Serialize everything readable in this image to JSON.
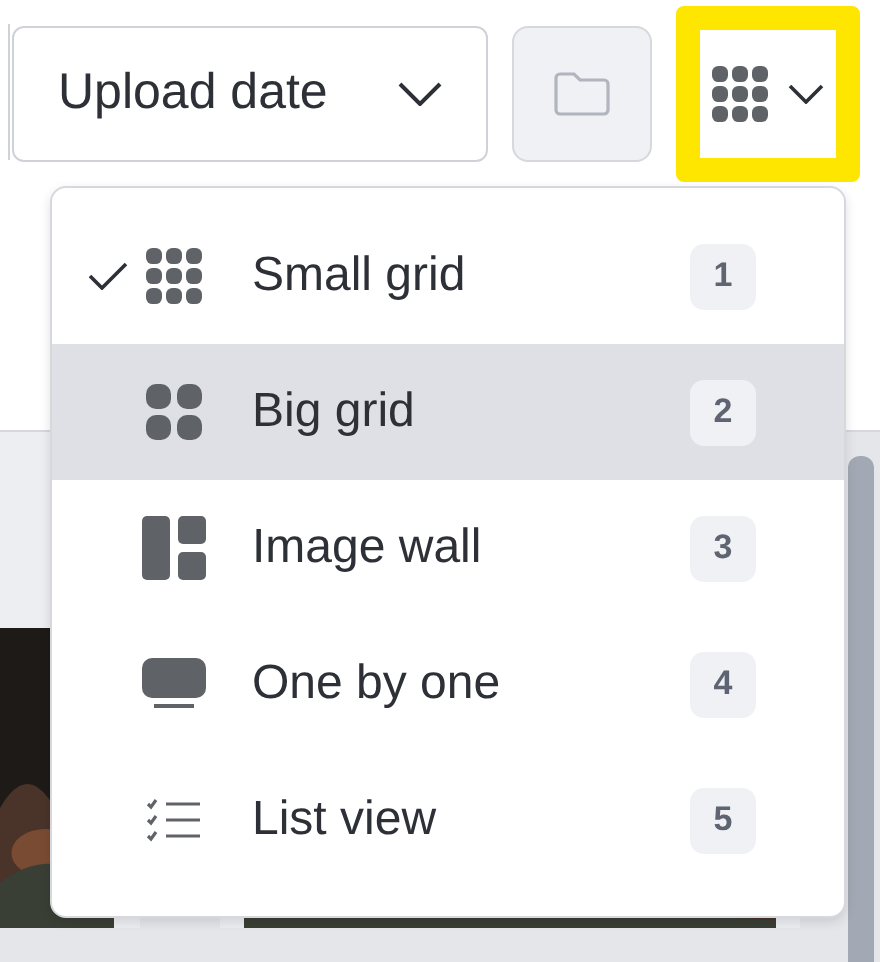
{
  "toolbar": {
    "sort": {
      "value": "Upload date"
    },
    "view_button": {
      "focused": true
    }
  },
  "view_menu": {
    "items": [
      {
        "label": "Small grid",
        "shortcut": "1",
        "selected": true,
        "highlighted": false,
        "kind": "small-grid"
      },
      {
        "label": "Big grid",
        "shortcut": "2",
        "selected": false,
        "highlighted": true,
        "kind": "big-grid"
      },
      {
        "label": "Image wall",
        "shortcut": "3",
        "selected": false,
        "highlighted": false,
        "kind": "wall"
      },
      {
        "label": "One by one",
        "shortcut": "4",
        "selected": false,
        "highlighted": false,
        "kind": "single"
      },
      {
        "label": "List view",
        "shortcut": "5",
        "selected": false,
        "highlighted": false,
        "kind": "list"
      }
    ]
  }
}
